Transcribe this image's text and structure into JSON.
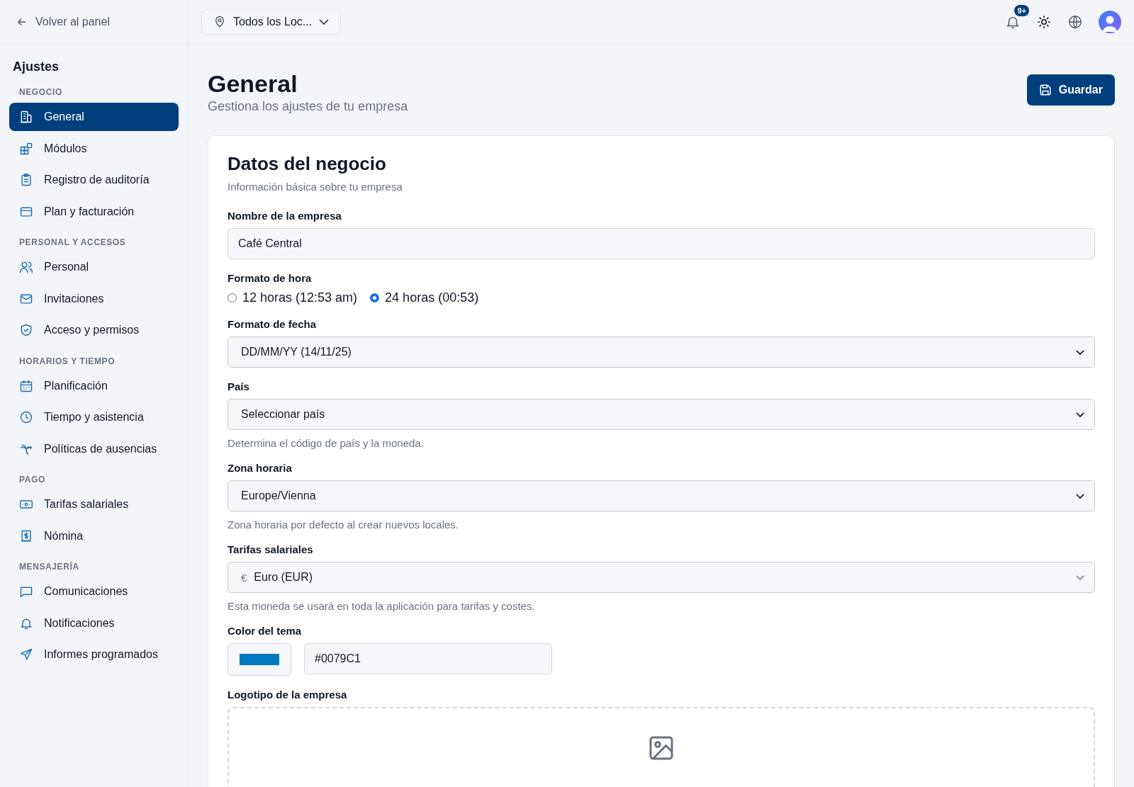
{
  "back_link": "Volver al panel",
  "location_selector": {
    "value": "Todos los Loc..."
  },
  "notifications": {
    "badge": "9+"
  },
  "sidebar": {
    "title": "Ajustes",
    "sections": [
      {
        "title": "NEGOCIO",
        "items": [
          {
            "label": "General",
            "selected": true
          },
          {
            "label": "Módulos",
            "selected": false
          },
          {
            "label": "Registro de auditoría",
            "selected": false
          },
          {
            "label": "Plan y facturación",
            "selected": false
          }
        ]
      },
      {
        "title": "PERSONAL Y ACCESOS",
        "items": [
          {
            "label": "Personal",
            "selected": false
          },
          {
            "label": "Invitaciones",
            "selected": false
          },
          {
            "label": "Acceso y permisos",
            "selected": false
          }
        ]
      },
      {
        "title": "HORARIOS Y TIEMPO",
        "items": [
          {
            "label": "Planificación",
            "selected": false
          },
          {
            "label": "Tiempo y asistencia",
            "selected": false
          },
          {
            "label": "Políticas de ausencias",
            "selected": false
          }
        ]
      },
      {
        "title": "PAGO",
        "items": [
          {
            "label": "Tarifas salariales",
            "selected": false
          },
          {
            "label": "Nómina",
            "selected": false
          }
        ]
      },
      {
        "title": "MENSAJERÍA",
        "items": [
          {
            "label": "Comunicaciones",
            "selected": false
          },
          {
            "label": "Notificaciones",
            "selected": false
          },
          {
            "label": "Informes programados",
            "selected": false
          }
        ]
      }
    ]
  },
  "page": {
    "title": "General",
    "subtitle": "Gestiona los ajustes de tu empresa",
    "save_button": "Guardar"
  },
  "card": {
    "title": "Datos del negocio",
    "subtitle": "Información básica sobre tu empresa",
    "fields": [
      {
        "kind": "text",
        "label": "Nombre de la empresa",
        "value": "Café Central"
      },
      {
        "kind": "radio",
        "label": "Formato de hora",
        "options": [
          {
            "label": "12 horas (12:53 am)",
            "selected": false
          },
          {
            "label": "24 horas (00:53)",
            "selected": true
          }
        ]
      },
      {
        "kind": "select",
        "label": "Formato de fecha",
        "value": "DD/MM/YY (14/11/25)"
      },
      {
        "kind": "select",
        "label": "País",
        "value": "Seleccionar país",
        "help": "Determina el código de país y la moneda."
      },
      {
        "kind": "select",
        "label": "Zona horaria",
        "value": "Europe/Vienna",
        "help": "Zona horaria por defecto al crear nuevos locales."
      },
      {
        "kind": "currency",
        "label": "Tarifas salariales",
        "symbol": "€",
        "value": "Euro (EUR)",
        "help": "Esta moneda se usará en toda la aplicación para tarifas y costes."
      },
      {
        "kind": "color",
        "label": "Color del tema",
        "value": "#0079C1"
      },
      {
        "kind": "upload",
        "label": "Logotipo de la empresa"
      }
    ]
  }
}
